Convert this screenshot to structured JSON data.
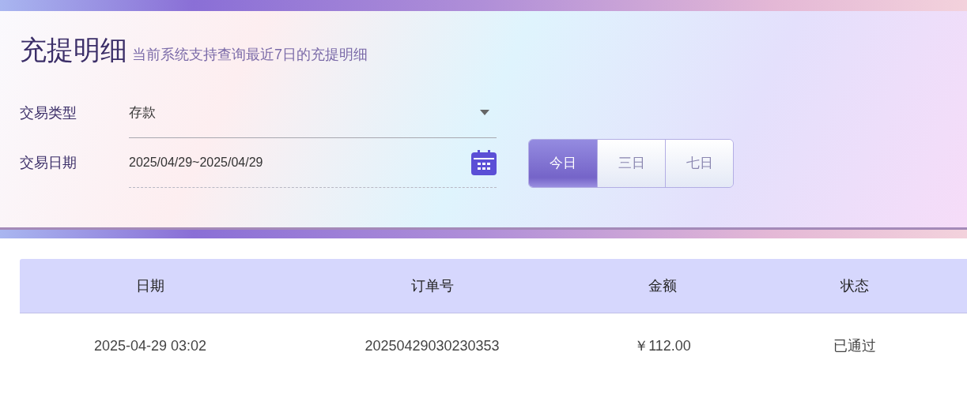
{
  "title": "充提明细",
  "subtitle": "当前系统支持查询最近7日的充提明细",
  "filters": [
    {
      "kind": "select",
      "label": "交易类型",
      "value": "存款"
    },
    {
      "kind": "date",
      "label": "交易日期",
      "value": "2025/04/29~2025/04/29"
    }
  ],
  "ranges": [
    {
      "label": "今日",
      "selected": true
    },
    {
      "label": "三日",
      "selected": false
    },
    {
      "label": "七日",
      "selected": false
    }
  ],
  "table": {
    "columns": [
      "日期",
      "订单号",
      "金额",
      "状态"
    ],
    "rows": [
      [
        "2025-04-29 03:02",
        "20250429030230353",
        "￥112.00",
        "已通过"
      ]
    ]
  }
}
